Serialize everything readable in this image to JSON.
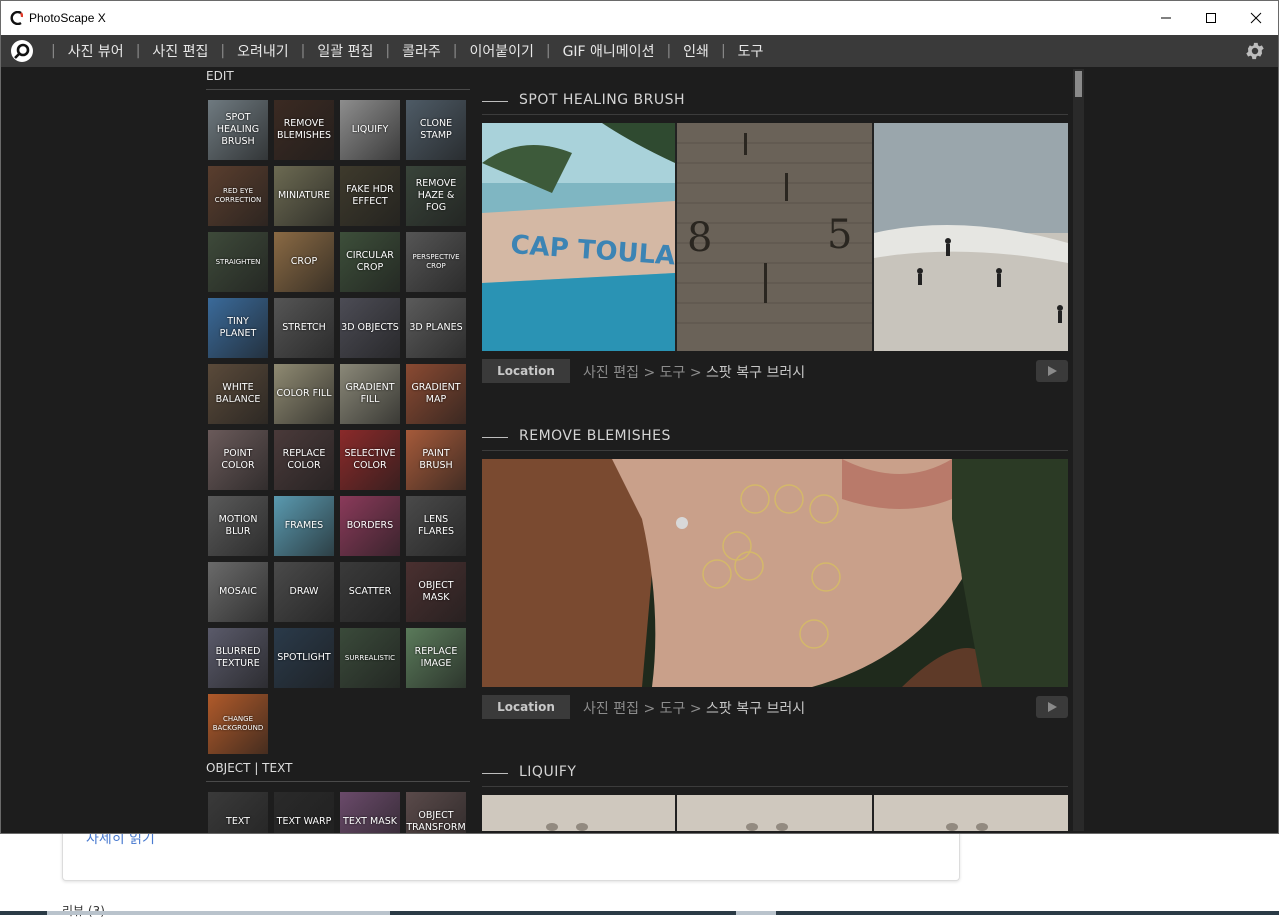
{
  "window": {
    "title": "PhotoScape X",
    "controls": {
      "minimize": "minimize-icon",
      "maximize": "maximize-icon",
      "close": "close-icon"
    }
  },
  "menu": {
    "items": [
      "사진 뷰어",
      "사진 편집",
      "오려내기",
      "일괄 편집",
      "콜라주",
      "이어붙이기",
      "GIF 애니메이션",
      "인쇄",
      "도구"
    ],
    "separator": "|",
    "settings_icon": "gear-icon"
  },
  "edit_section": {
    "title": "EDIT",
    "tools": [
      {
        "label": "SPOT HEALING BRUSH",
        "bg": "#6f7a80"
      },
      {
        "label": "REMOVE BLEMISHES",
        "bg": "#3b2a22"
      },
      {
        "label": "LIQUIFY",
        "bg": "#8d8d8d"
      },
      {
        "label": "CLONE STAMP",
        "bg": "#4e5b66"
      },
      {
        "label": "RED EYE CORRECTION",
        "bg": "#5a3e2e",
        "small": true
      },
      {
        "label": "MINIATURE",
        "bg": "#6c6a52"
      },
      {
        "label": "FAKE HDR EFFECT",
        "bg": "#3e3a2c"
      },
      {
        "label": "REMOVE HAZE & FOG",
        "bg": "#39443a"
      },
      {
        "label": "STRAIGHTEN",
        "bg": "#3e4a3a",
        "small": true
      },
      {
        "label": "CROP",
        "bg": "#8a6a44"
      },
      {
        "label": "CIRCULAR CROP",
        "bg": "#3d4f3a"
      },
      {
        "label": "PERSPECTIVE CROP",
        "bg": "#555555",
        "small": true
      },
      {
        "label": "TINY PLANET",
        "bg": "#3a6a9a"
      },
      {
        "label": "STRETCH",
        "bg": "#555555"
      },
      {
        "label": "3D OBJECTS",
        "bg": "#4c4c55"
      },
      {
        "label": "3D PLANES",
        "bg": "#5b5b5b"
      },
      {
        "label": "WHITE BALANCE",
        "bg": "#5a4a3a"
      },
      {
        "label": "COLOR FILL",
        "bg": "#8f8a72"
      },
      {
        "label": "GRADIENT FILL",
        "bg": "#8a8878"
      },
      {
        "label": "GRADIENT MAP",
        "bg": "#8a4a32"
      },
      {
        "label": "POINT COLOR",
        "bg": "#6a5a5a"
      },
      {
        "label": "REPLACE COLOR",
        "bg": "#4a3a3a"
      },
      {
        "label": "SELECTIVE COLOR",
        "bg": "#8a2a2a"
      },
      {
        "label": "PAINT BRUSH",
        "bg": "#a55a3a"
      },
      {
        "label": "MOTION BLUR",
        "bg": "#5a5a5a"
      },
      {
        "label": "FRAMES",
        "bg": "#5a9ab0"
      },
      {
        "label": "BORDERS",
        "bg": "#8a3a5a"
      },
      {
        "label": "LENS FLARES",
        "bg": "#4a4a4a"
      },
      {
        "label": "MOSAIC",
        "bg": "#6a6a6a"
      },
      {
        "label": "DRAW",
        "bg": "#4a4a4a"
      },
      {
        "label": "SCATTER",
        "bg": "#3a3a3a"
      },
      {
        "label": "OBJECT MASK",
        "bg": "#4a3030"
      },
      {
        "label": "BLURRED TEXTURE",
        "bg": "#5a5a6a"
      },
      {
        "label": "SPOTLIGHT",
        "bg": "#2a3a4a"
      },
      {
        "label": "SURREALISTIC",
        "bg": "#3a4a3a",
        "small": true
      },
      {
        "label": "REPLACE IMAGE",
        "bg": "#5a7a5a"
      },
      {
        "label": "CHANGE BACKGROUND",
        "bg": "#b05a2a",
        "small": true
      }
    ]
  },
  "object_section": {
    "title": "OBJECT | TEXT",
    "tools": [
      {
        "label": "TEXT",
        "bg": "#3a3a3a"
      },
      {
        "label": "TEXT WARP",
        "bg": "#2a2a2a"
      },
      {
        "label": "TEXT MASK",
        "bg": "#6a4a6a"
      },
      {
        "label": "OBJECT TRANSFORM",
        "bg": "#5a4a4a"
      }
    ]
  },
  "features": [
    {
      "name": "SPOT HEALING BRUSH",
      "location_label": "Location",
      "path": [
        "사진 편집",
        "도구",
        "스팟 복구 브러시"
      ]
    },
    {
      "name": "REMOVE BLEMISHES",
      "location_label": "Location",
      "path": [
        "사진 편집",
        "도구",
        "스팟 복구 브러시"
      ]
    },
    {
      "name": "LIQUIFY"
    }
  ],
  "background_page": {
    "link_text": "자세히 읽기",
    "bottom_text": "리뷰 (3)"
  }
}
